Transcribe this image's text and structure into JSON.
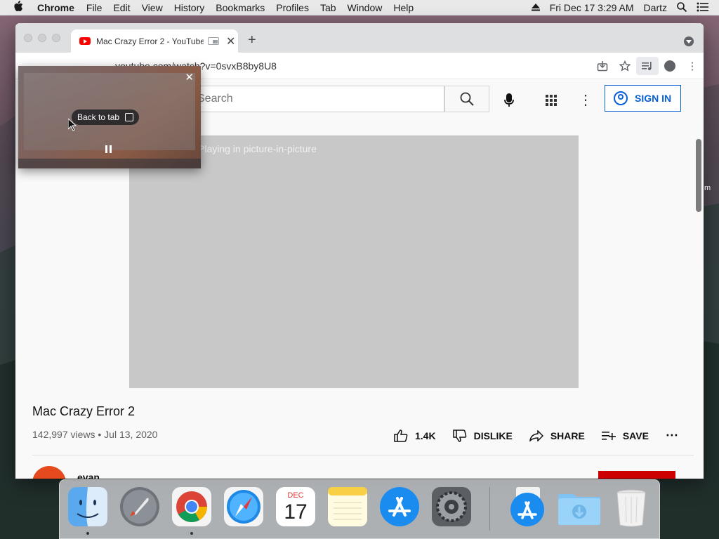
{
  "menubar": {
    "app_name": "Chrome",
    "items": [
      "File",
      "Edit",
      "View",
      "History",
      "Bookmarks",
      "Profiles",
      "Tab",
      "Window",
      "Help"
    ],
    "datetime": "Fri Dec 17  3:29 AM",
    "user": "Dartz"
  },
  "browser": {
    "tab_title": "Mac Crazy Error 2 - YouTube",
    "url": "youtube.com/watch?v=0svxB8by8U8"
  },
  "youtube": {
    "search_placeholder": "Search",
    "signin_label": "SIGN IN",
    "player_message": "Playing in picture-in-picture",
    "video_title": "Mac Crazy Error 2",
    "meta": "142,997 views • Jul 13, 2020",
    "like_count": "1.4K",
    "dislike_label": "DISLIKE",
    "share_label": "SHARE",
    "save_label": "SAVE",
    "channel_name": "evan"
  },
  "pip": {
    "back_to_tab": "Back to tab"
  },
  "dock": {
    "calendar_month": "DEC",
    "calendar_day": "17",
    "apps": [
      "Finder",
      "Launchpad",
      "Google Chrome",
      "Safari",
      "Calendar",
      "Notes",
      "App Store",
      "System Preferences",
      "App Store Downloads",
      "Downloads",
      "Trash"
    ]
  },
  "colors": {
    "youtube_red": "#ff0000",
    "signin_blue": "#065fd4",
    "subscribe_red": "#cc0000"
  }
}
